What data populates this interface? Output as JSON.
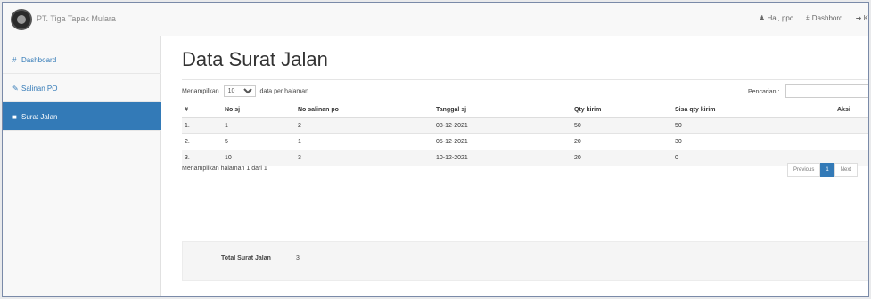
{
  "navbar": {
    "brand": "PT. Tiga Tapak Mulara",
    "user_label": "Hai, ppc",
    "dashboard_label": "Dashbord",
    "logout_label": "K"
  },
  "sidebar": {
    "items": [
      {
        "label": "Dashboard",
        "icon": "dashboard-icon"
      },
      {
        "label": "Salinan PO",
        "icon": "edit-icon"
      },
      {
        "label": "Surat Jalan",
        "icon": "document-icon",
        "active": true
      }
    ]
  },
  "page": {
    "title": "Data Surat Jalan"
  },
  "table_controls": {
    "show_prefix": "Menampilkan",
    "page_size": "10",
    "show_suffix": "data per halaman",
    "search_label": "Pencarian :",
    "search_value": ""
  },
  "table": {
    "columns": [
      "#",
      "No sj",
      "No salinan po",
      "Tanggal sj",
      "Qty kirim",
      "Sisa qty kirim",
      "Aksi"
    ],
    "rows": [
      [
        "1.",
        "1",
        "2",
        "08-12-2021",
        "50",
        "50"
      ],
      [
        "2.",
        "5",
        "1",
        "05-12-2021",
        "20",
        "30"
      ],
      [
        "3.",
        "10",
        "3",
        "10-12-2021",
        "20",
        "0"
      ]
    ],
    "action_symbol": "+"
  },
  "table_info": "Menampilkan halaman 1 dari 1",
  "pagination": {
    "previous": "Previous",
    "current": "1",
    "next": "Next"
  },
  "summary": {
    "label": "Total Surat Jalan",
    "value": "3"
  },
  "colors": {
    "accent": "#337ab7"
  }
}
